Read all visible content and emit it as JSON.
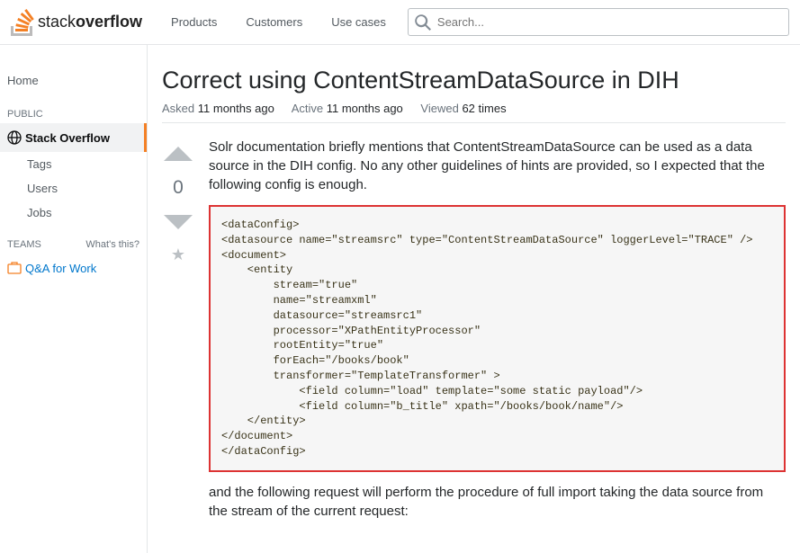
{
  "header": {
    "logo_text_light": "stack",
    "logo_text_bold": "overflow",
    "nav": [
      "Products",
      "Customers",
      "Use cases"
    ],
    "search_placeholder": "Search..."
  },
  "sidebar": {
    "home": "Home",
    "public_label": "PUBLIC",
    "stack_overflow": "Stack Overflow",
    "subs": [
      "Tags",
      "Users",
      "Jobs"
    ],
    "teams_label": "TEAMS",
    "whats_this": "What's this?",
    "qa_work": "Q&A for Work"
  },
  "question": {
    "title": "Correct using ContentStreamDataSource in DIH",
    "asked_label": "Asked",
    "asked_value": "11 months ago",
    "active_label": "Active",
    "active_value": "11 months ago",
    "viewed_label": "Viewed",
    "viewed_value": "62 times",
    "vote_count": "0",
    "body_p1": "Solr documentation briefly mentions that ContentStreamDataSource can be used as a data source in the DIH config. No any other guidelines of hints are provided, so I expected that the following config is enough.",
    "code": "<dataConfig>\n<datasource name=\"streamsrc\" type=\"ContentStreamDataSource\" loggerLevel=\"TRACE\" />\n<document>\n    <entity\n        stream=\"true\"\n        name=\"streamxml\"\n        datasource=\"streamsrc1\"\n        processor=\"XPathEntityProcessor\"\n        rootEntity=\"true\"\n        forEach=\"/books/book\"\n        transformer=\"TemplateTransformer\" >\n            <field column=\"load\" template=\"some static payload\"/>\n            <field column=\"b_title\" xpath=\"/books/book/name\"/>\n    </entity>\n</document>\n</dataConfig>",
    "body_p2": "and the following request will perform the procedure of full import taking the data source from the stream of the current request:"
  }
}
